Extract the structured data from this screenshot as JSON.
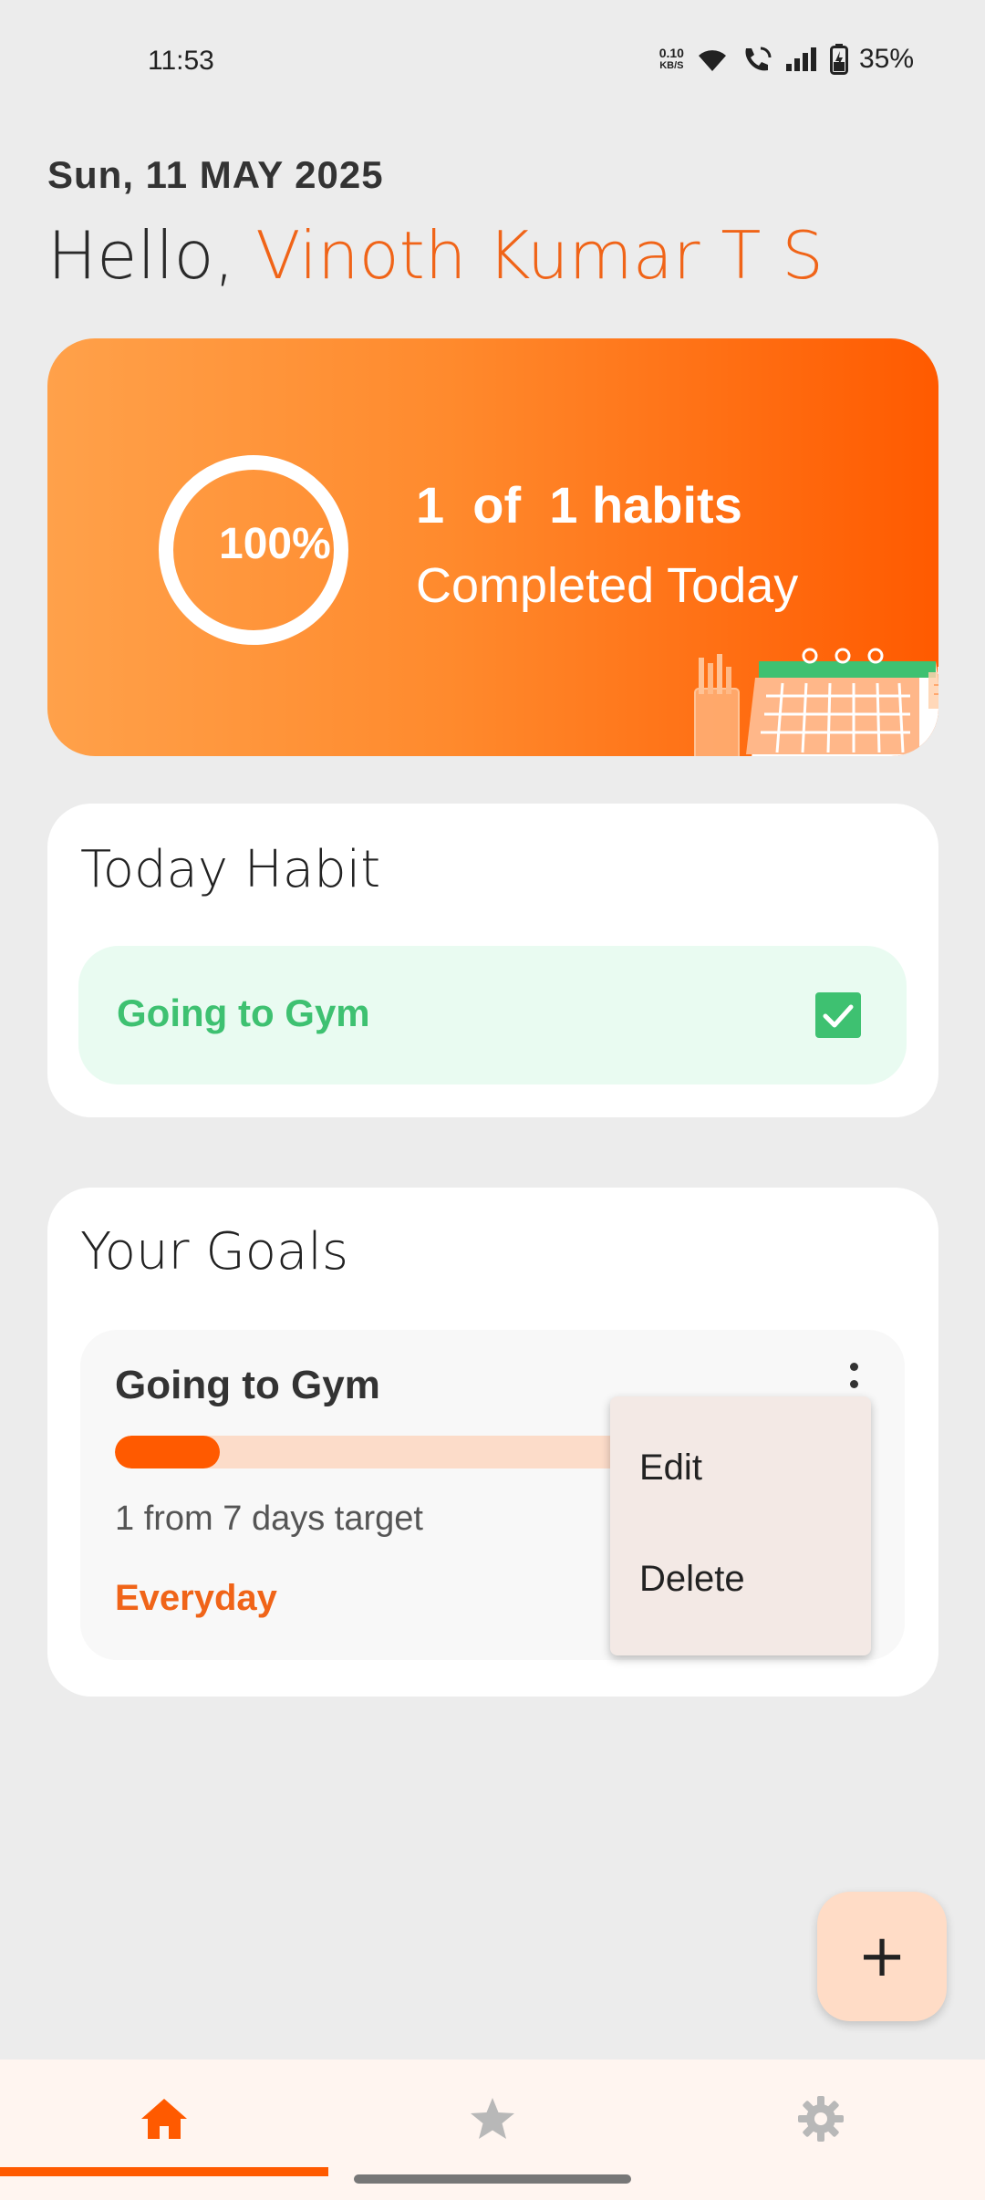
{
  "status_bar": {
    "time": "11:53",
    "net_speed_value": "0.10",
    "net_speed_unit": "KB/S",
    "battery": "35%",
    "icons": [
      "wifi-icon",
      "wifi-call-icon",
      "signal-icon",
      "battery-charging-icon"
    ]
  },
  "header": {
    "date": "Sun, 11 MAY 2025",
    "greeting": "Hello, ",
    "user_name": "Vinoth Kumar T S"
  },
  "summary": {
    "percent": "100%",
    "percent_value": 1.0,
    "line1": "1  of  1 habits",
    "line2": "Completed Today"
  },
  "today_habit": {
    "title": "Today Habit",
    "items": [
      {
        "label": "Going to Gym",
        "checked": true
      }
    ]
  },
  "goals": {
    "title": "Your Goals",
    "items": [
      {
        "title": "Going to Gym",
        "progress": 0.14,
        "target_text": "1 from 7 days target",
        "frequency": "Everyday"
      }
    ]
  },
  "context_menu": {
    "edit": "Edit",
    "delete": "Delete"
  },
  "fab": {
    "label": "+"
  },
  "bottom_nav": {
    "items": [
      {
        "icon": "home-icon",
        "active": true
      },
      {
        "icon": "star-icon",
        "active": false
      },
      {
        "icon": "gear-icon",
        "active": false
      }
    ]
  },
  "colors": {
    "accent": "#ff5a00",
    "name": "#f06418",
    "success": "#3ec171",
    "inactive_icon": "#b8b8b8"
  }
}
